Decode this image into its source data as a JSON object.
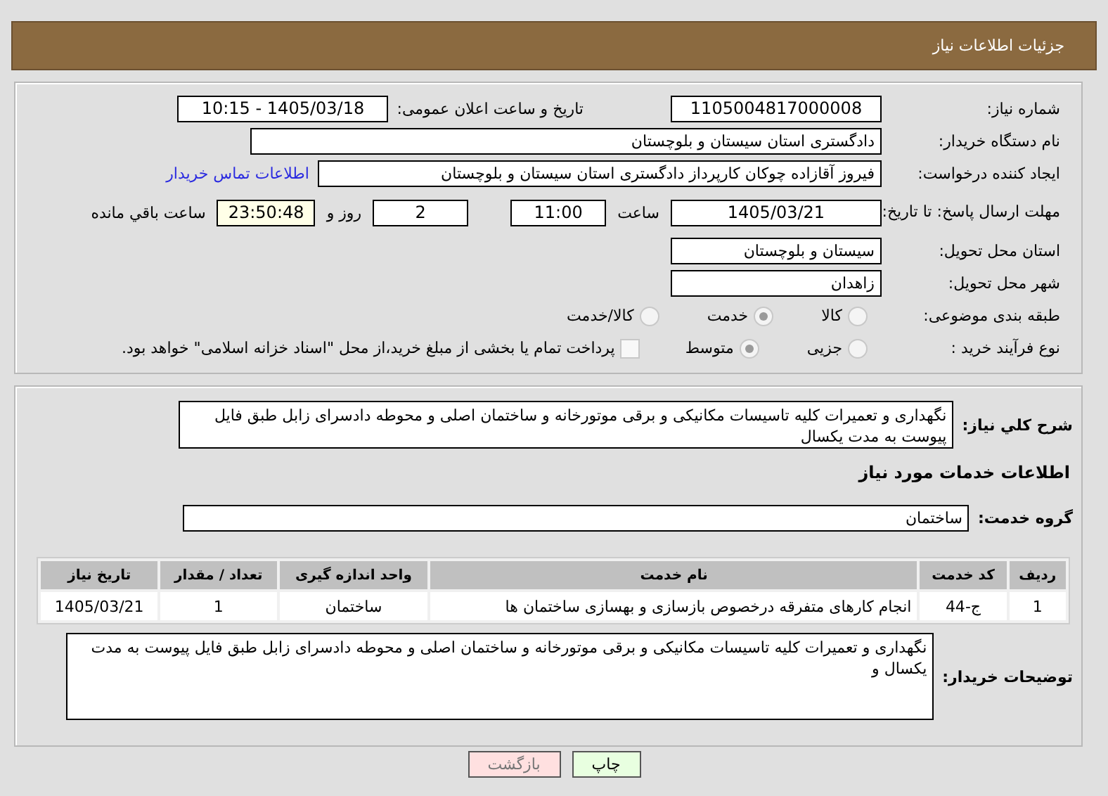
{
  "header": {
    "title": "جزئیات اطلاعات نیاز"
  },
  "need_number": {
    "label": "شماره نیاز:",
    "value": "1105004817000008"
  },
  "announce": {
    "label": "تاریخ و ساعت اعلان عمومی:",
    "value": "1405/03/18 - 10:15"
  },
  "buyer_org": {
    "label": "نام دستگاه خریدار:",
    "value": "دادگستری استان سیستان و بلوچستان"
  },
  "requester": {
    "label": "ایجاد کننده درخواست:",
    "value": "فیروز آقازاده چوکان کارپرداز دادگستری استان سیستان و بلوچستان",
    "link": "اطلاعات تماس خریدار"
  },
  "deadline": {
    "label": "مهلت ارسال پاسخ: تا تاریخ:",
    "date": "1405/03/21",
    "time_label": "ساعت",
    "time": "11:00",
    "days": "2",
    "days_label": "روز و",
    "remaining": "23:50:48",
    "remaining_label": "ساعت باقي مانده"
  },
  "province": {
    "label": "استان محل تحویل:",
    "value": "سیستان و بلوچستان"
  },
  "city": {
    "label": "شهر محل تحویل:",
    "value": "زاهدان"
  },
  "category": {
    "label": "طبقه بندی موضوعی:",
    "options": [
      {
        "label": "کالا",
        "selected": false
      },
      {
        "label": "خدمت",
        "selected": true
      },
      {
        "label": "کالا/خدمت",
        "selected": false
      }
    ]
  },
  "process": {
    "label": "نوع فرآیند خرید :",
    "options": [
      {
        "label": "جزیی",
        "selected": false
      },
      {
        "label": "متوسط",
        "selected": true
      }
    ],
    "payment": {
      "label": "پرداخت تمام یا بخشی از مبلغ خرید،از محل \"اسناد خزانه اسلامی\" خواهد بود.",
      "checked": false
    }
  },
  "description": {
    "label": "شرح کلي نياز:",
    "value": "نگهداری و تعمیرات کلیه تاسیسات مکانیکی و برقی موتورخانه و ساختمان اصلی و محوطه دادسرای زابل طبق فایل پیوست به مدت یکسال"
  },
  "services_title": "اطلاعات خدمات مورد نیاز",
  "service_group": {
    "label": "گروه خدمت:",
    "value": "ساختمان"
  },
  "table": {
    "columns": [
      "ردیف",
      "کد خدمت",
      "نام خدمت",
      "واحد اندازه گیری",
      "تعداد / مقدار",
      "تاریخ نیاز"
    ],
    "rows": [
      [
        "1",
        "ج-44",
        "انجام کارهای متفرقه درخصوص بازسازی و بهسازی ساختمان ها",
        "ساختمان",
        "1",
        "1405/03/21"
      ]
    ]
  },
  "buyer_notes": {
    "label": "توضیحات خریدار:",
    "value": "نگهداری و تعمیرات کلیه تاسیسات مکانیکی و برقی موتورخانه و ساختمان اصلی و محوطه دادسرای زابل طبق فایل پیوست به مدت یکسال و"
  },
  "buttons": [
    {
      "label": "چاپ",
      "kind": "print"
    },
    {
      "label": "بازگشت",
      "kind": "back"
    }
  ]
}
